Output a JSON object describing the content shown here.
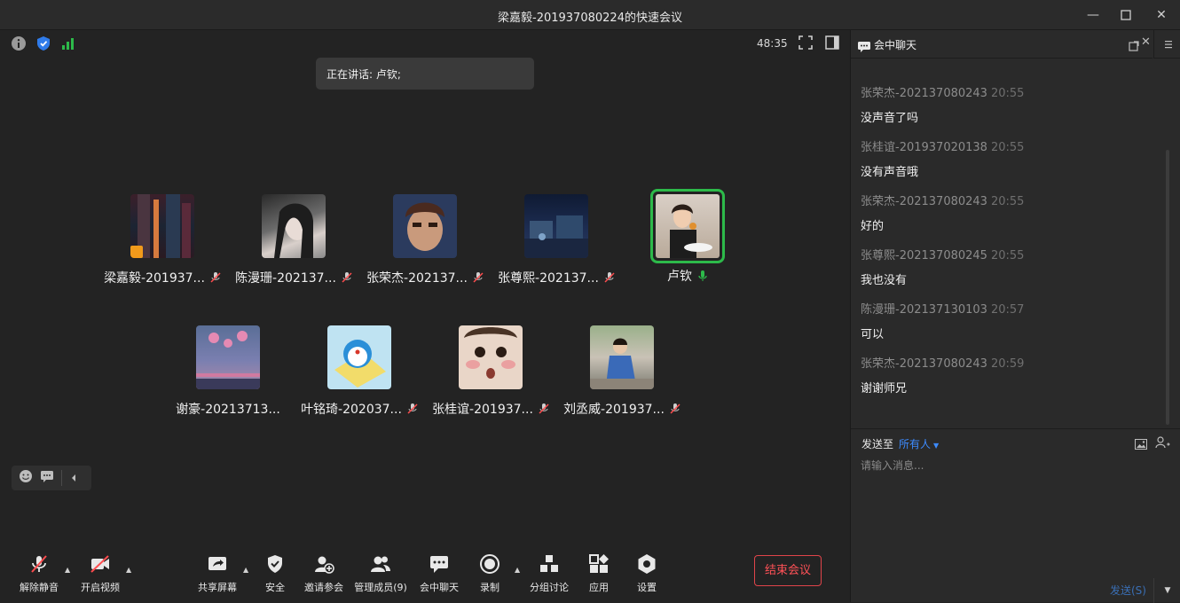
{
  "window": {
    "title": "梁嘉毅-201937080224的快速会议"
  },
  "meeting": {
    "timer": "48:35",
    "speaking_label": "正在讲话: 卢钦;"
  },
  "participants": [
    {
      "name": "梁嘉毅-201937..."
    },
    {
      "name": "陈漫珊-202137..."
    },
    {
      "name": "张荣杰-202137..."
    },
    {
      "name": "张尊熙-202137..."
    },
    {
      "name": "卢钦"
    },
    {
      "name": "谢豪-20213713..."
    },
    {
      "name": "叶铭琦-202037..."
    },
    {
      "name": "张桂谊-201937..."
    },
    {
      "name": "刘丞威-201937..."
    }
  ],
  "toolbar": {
    "unmute": "解除静音",
    "start_video": "开启视频",
    "share_screen": "共享屏幕",
    "security": "安全",
    "invite": "邀请参会",
    "manage_members": "管理成员(9)",
    "chat": "会中聊天",
    "record": "录制",
    "breakout": "分组讨论",
    "apps": "应用",
    "settings": "设置",
    "end_meeting": "结束会议"
  },
  "chat": {
    "title": "会中聊天",
    "messages": [
      {
        "sender": "张荣杰-202137080243",
        "time": "20:55",
        "text": "没声音了吗"
      },
      {
        "sender": "张桂谊-201937020138",
        "time": "20:55",
        "text": "没有声音哦"
      },
      {
        "sender": "张荣杰-202137080243",
        "time": "20:55",
        "text": "好的"
      },
      {
        "sender": "张尊熙-202137080245",
        "time": "20:55",
        "text": "我也没有"
      },
      {
        "sender": "陈漫珊-202137130103",
        "time": "20:57",
        "text": "可以"
      },
      {
        "sender": "张荣杰-202137080243",
        "time": "20:59",
        "text": "谢谢师兄"
      }
    ],
    "send_to_label": "发送至",
    "send_to_target": "所有人",
    "input_placeholder": "请输入消息...",
    "send_button": "发送(S)"
  },
  "colors": {
    "accent_green": "#2dba4a",
    "end_red": "#ff5157",
    "link_blue": "#3d8bff"
  }
}
